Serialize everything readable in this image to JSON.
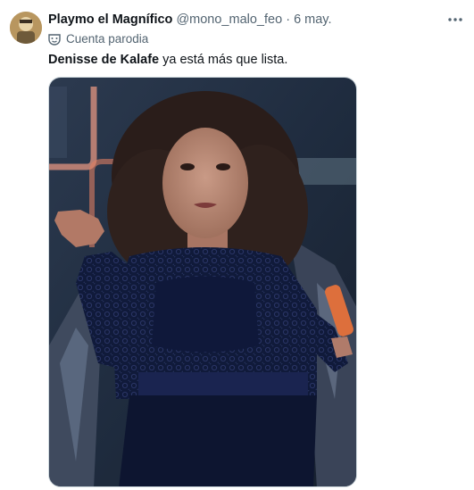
{
  "tweet": {
    "author_name": "Playmo el Magnífico",
    "handle": "@mono_malo_feo",
    "separator": "·",
    "date": "6 may.",
    "label": "Cuenta parodia",
    "text_bold": "Denisse de Kalafe",
    "text_rest": " ya está más que lista.",
    "more_icon": "ellipsis-icon",
    "label_icon": "theater-mask-icon"
  },
  "colors": {
    "text_primary": "#0f1419",
    "text_secondary": "#536471",
    "border": "#cfd9de"
  }
}
